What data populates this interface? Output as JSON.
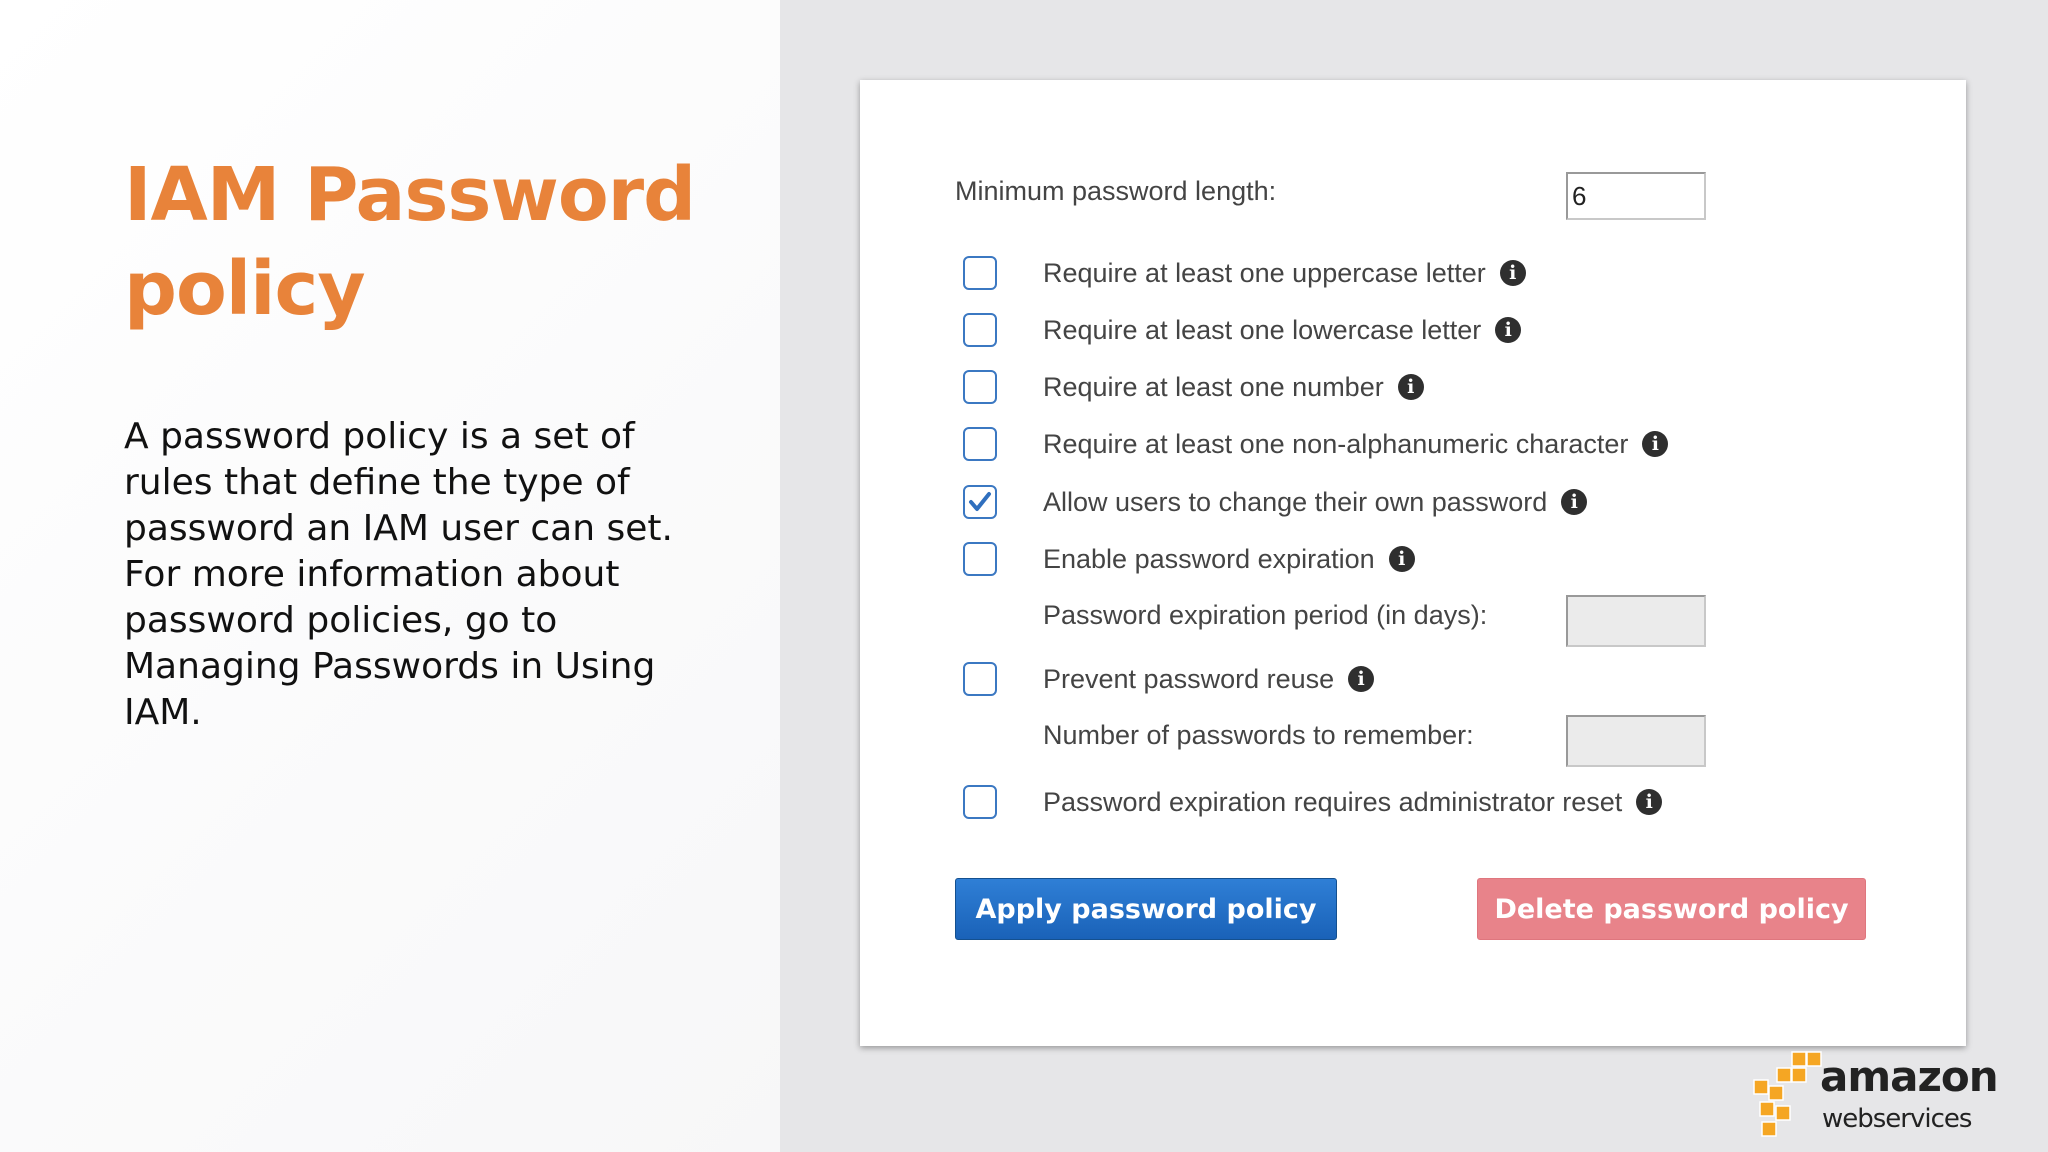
{
  "slide": {
    "title": "IAM Password policy",
    "body": "A password policy is a set of rules that define the type of password an IAM user can set. For more information about password policies, go to Managing Passwords in Using IAM."
  },
  "form": {
    "min_length_label": "Minimum password length:",
    "min_length_value": "6",
    "options": [
      {
        "label": "Require at least one uppercase letter",
        "checked": false
      },
      {
        "label": "Require at least one lowercase letter",
        "checked": false
      },
      {
        "label": "Require at least one number",
        "checked": false
      },
      {
        "label": "Require at least one non-alphanumeric character",
        "checked": false
      },
      {
        "label": "Allow users to change their own password",
        "checked": true
      },
      {
        "label": "Enable password expiration",
        "checked": false
      },
      {
        "label": "Prevent password reuse",
        "checked": false
      },
      {
        "label": "Password expiration requires administrator reset",
        "checked": false
      }
    ],
    "expiration_period_label": "Password expiration period (in days):",
    "passwords_to_remember_label": "Number of passwords to remember:",
    "apply_button": "Apply password policy",
    "delete_button": "Delete password policy",
    "info_glyph": "i"
  },
  "logo": {
    "word_main": "amazon",
    "word_sub": "webservices"
  },
  "colors": {
    "title": "#e8833a",
    "checkbox_border": "#3b78c2",
    "apply_button": "#1a62b8",
    "delete_button": "#e8838a",
    "logo_cubes": "#f5a623"
  },
  "icons": {
    "info": "info-icon",
    "check": "checkmark-icon",
    "logo": "aws-cubes-icon"
  }
}
